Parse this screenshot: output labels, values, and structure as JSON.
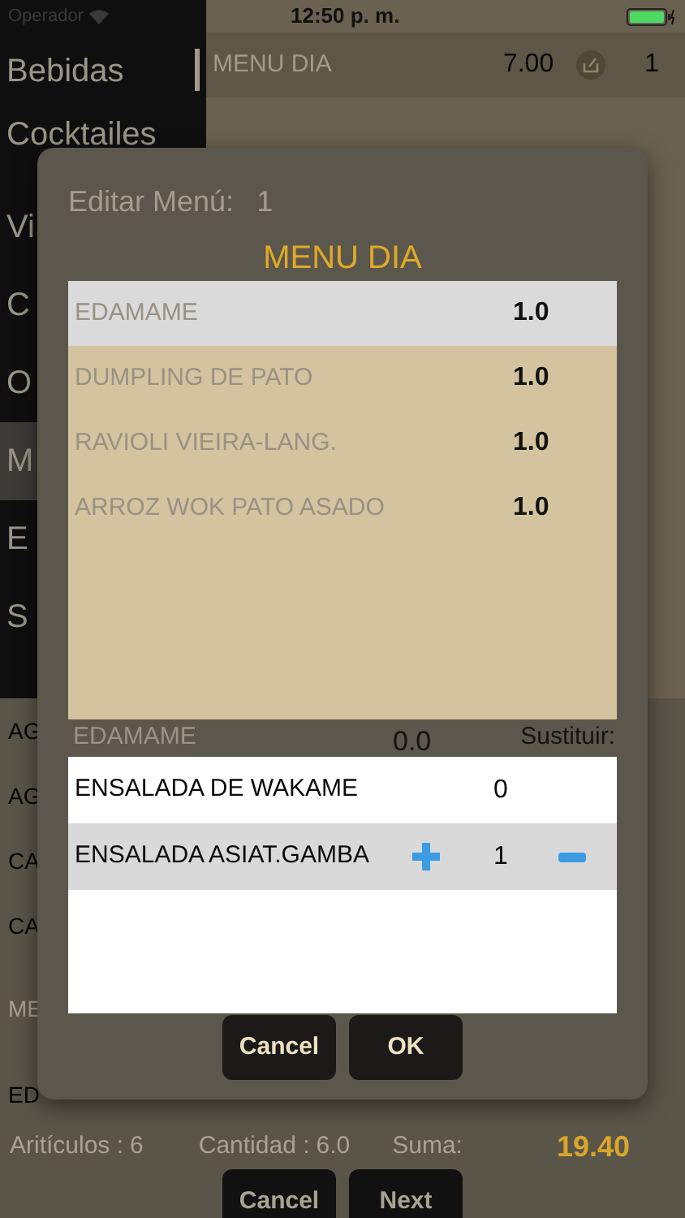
{
  "status_bar": {
    "carrier": "Operador",
    "time": "12:50 p. m."
  },
  "sidebar": {
    "items": [
      {
        "label": "Bebidas",
        "selected": false
      },
      {
        "label": "Cocktailes",
        "selected": false
      },
      {
        "label": "Vi",
        "selected": false
      },
      {
        "label": "C",
        "selected": false
      },
      {
        "label": "O",
        "selected": false
      },
      {
        "label": "M",
        "selected": true
      },
      {
        "label": "E",
        "selected": false
      },
      {
        "label": "S",
        "selected": false
      }
    ]
  },
  "header": {
    "title": "MENU DIA",
    "price": "7.00",
    "count": "1"
  },
  "order_rows": [
    {
      "name": "AG",
      "dimmed": false
    },
    {
      "name": "AG",
      "dimmed": false
    },
    {
      "name": "CA",
      "dimmed": false
    },
    {
      "name": "CA",
      "dimmed": false
    },
    {
      "name": "ME",
      "dimmed": true
    },
    {
      "name": "ED",
      "dimmed": false
    }
  ],
  "footer": {
    "articles_label": "Aritículos :",
    "articles": "6",
    "quantity_label": "Cantidad :",
    "quantity": "6.0",
    "sum_label": "Suma:",
    "sum": "19.40"
  },
  "buttons": [
    "Cancel",
    "Next"
  ],
  "dialog": {
    "title_label": "Editar Menú:",
    "title_value": "1",
    "menu_name": "MENU DIA",
    "items": [
      {
        "name": "EDAMAME",
        "qty": "1.0",
        "selected": true
      },
      {
        "name": "DUMPLING DE PATO",
        "qty": "1.0",
        "selected": false
      },
      {
        "name": "RAVIOLI VIEIRA-LANG.",
        "qty": "1.0",
        "selected": false
      },
      {
        "name": "ARROZ WOK PATO ASADO",
        "qty": "1.0",
        "selected": false
      }
    ],
    "current": {
      "name": "EDAMAME",
      "qty": "0.0",
      "label": "Sustituir:"
    },
    "substitutes": [
      {
        "name": "ENSALADA DE WAKAME",
        "qty": "0",
        "selected": false
      },
      {
        "name": "ENSALADA ASIAT.GAMBA",
        "qty": "1",
        "selected": true
      }
    ],
    "buttons": [
      "Cancel",
      "OK"
    ]
  }
}
